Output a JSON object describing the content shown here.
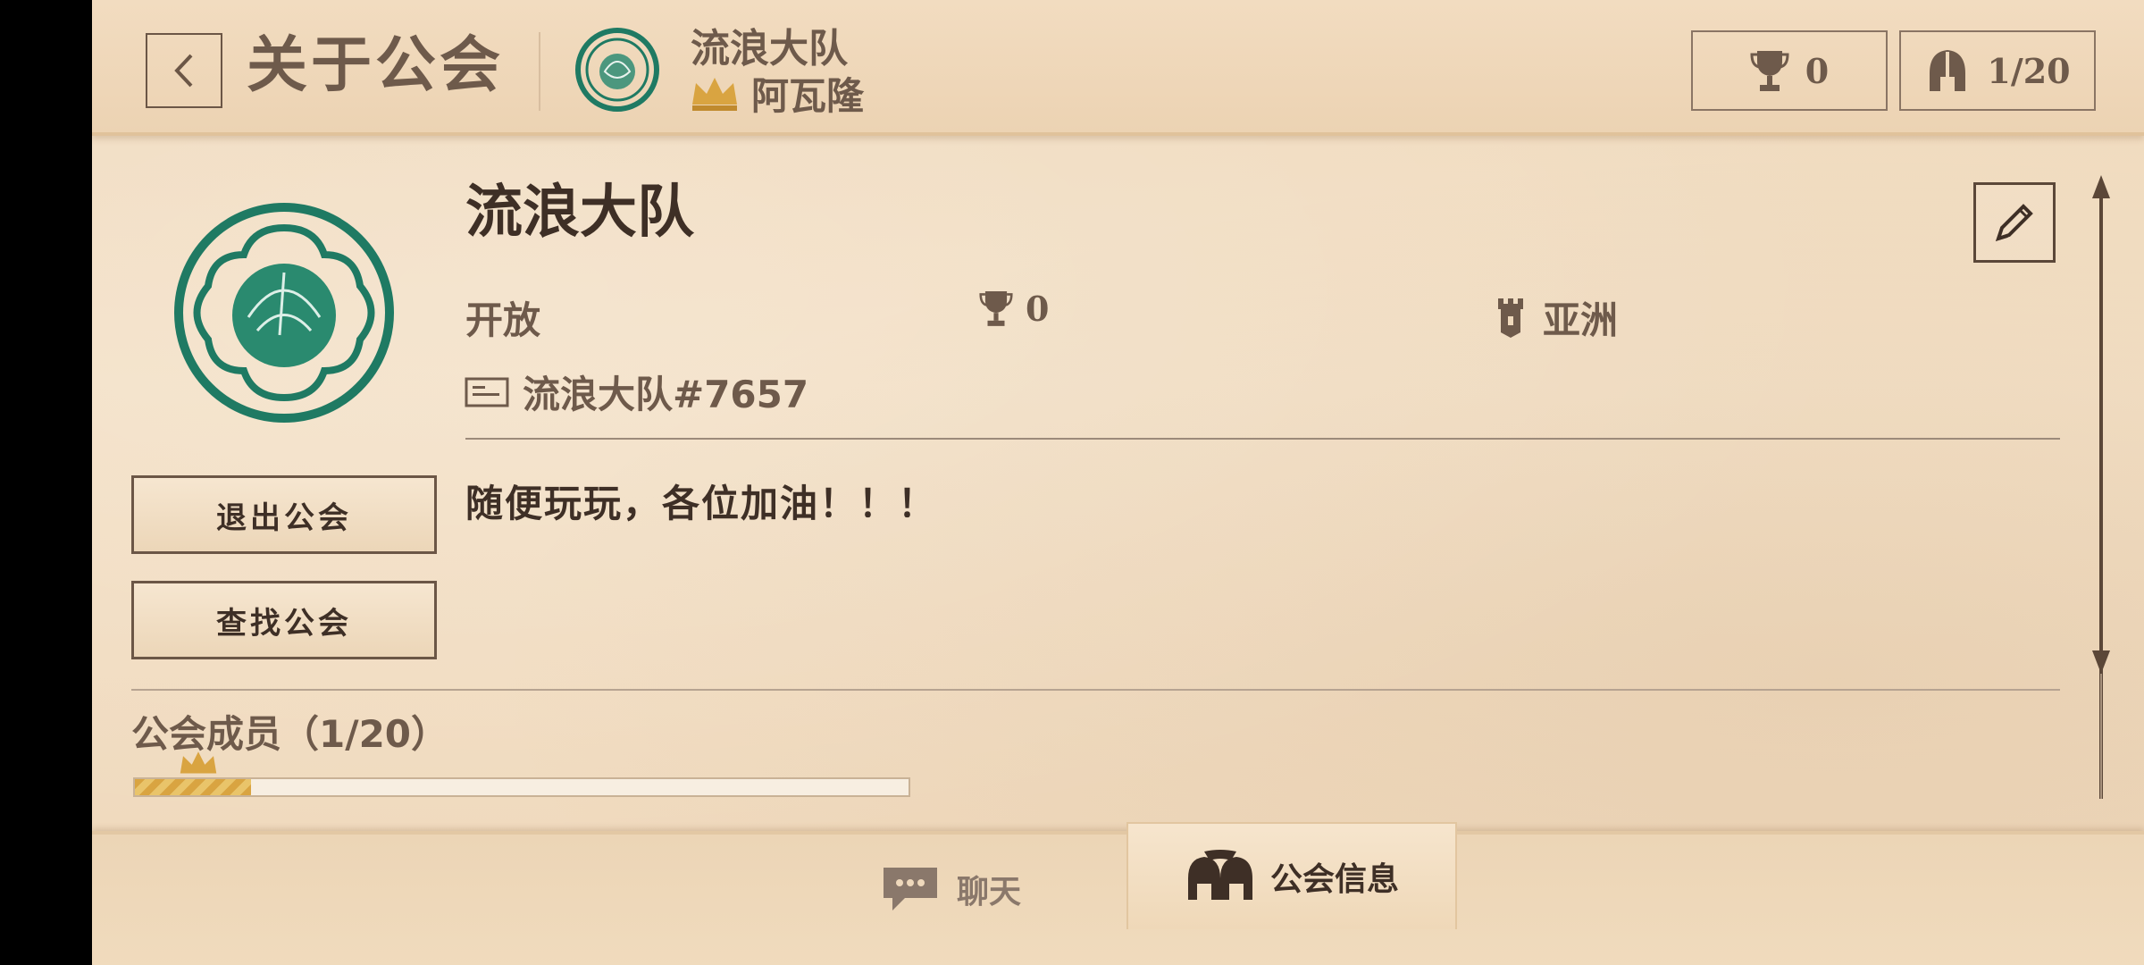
{
  "header": {
    "title": "关于公会",
    "guild_name": "流浪大队",
    "leader_name": "阿瓦隆",
    "trophies": "0",
    "members": "1/20"
  },
  "guild": {
    "name": "流浪大队",
    "status": "开放",
    "trophies": "0",
    "region": "亚洲",
    "tag": "流浪大队#7657",
    "description": "随便玩玩，各位加油！！！"
  },
  "actions": {
    "leave_label": "退出公会",
    "find_label": "查找公会"
  },
  "members": {
    "title": "公会成员（1/20）",
    "fill_fraction": 0.05
  },
  "tabs": {
    "chat_label": "聊天",
    "guild_info_label": "公会信息",
    "active": "guild_info"
  },
  "colors": {
    "emblem_green": "#1f7a63",
    "crown_gold": "#d9a441",
    "ink_dark": "#3e2f26",
    "ink_muted": "#6e5a4b"
  },
  "icons": [
    "back-arrow-icon",
    "trophy-icon",
    "helmet-icon",
    "crown-icon",
    "tower-icon",
    "id-card-icon",
    "pencil-icon",
    "chat-bubble-icon",
    "guild-helmets-icon"
  ]
}
